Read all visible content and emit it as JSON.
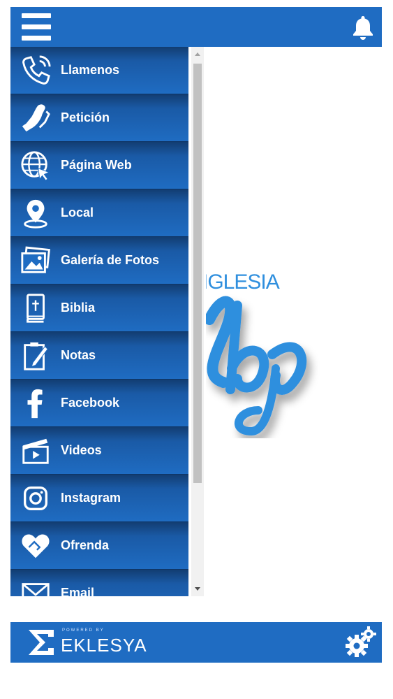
{
  "header": {
    "menu_icon": "hamburger-menu-icon",
    "notification_icon": "bell-icon"
  },
  "logo": {
    "top_text": "IGLESIA",
    "script_text": "ebp",
    "color": "#2f8fde"
  },
  "menu": {
    "items": [
      {
        "label": "Llamenos",
        "icon": "phone-icon"
      },
      {
        "label": "Petición",
        "icon": "praying-hands-icon"
      },
      {
        "label": "Página Web",
        "icon": "globe-cursor-icon"
      },
      {
        "label": "Local",
        "icon": "location-pin-icon"
      },
      {
        "label": "Galería de Fotos",
        "icon": "photo-gallery-icon"
      },
      {
        "label": "Biblia",
        "icon": "bible-icon"
      },
      {
        "label": "Notas",
        "icon": "notes-pencil-icon"
      },
      {
        "label": "Facebook",
        "icon": "facebook-icon"
      },
      {
        "label": "Videos",
        "icon": "video-clapper-icon"
      },
      {
        "label": "Instagram",
        "icon": "instagram-icon"
      },
      {
        "label": "Ofrenda",
        "icon": "heart-hands-icon"
      },
      {
        "label": "Email",
        "icon": "envelope-icon"
      }
    ]
  },
  "footer": {
    "powered_by": "POWERED BY",
    "brand": "EKLESYA",
    "settings_icon": "gears-icon"
  },
  "colors": {
    "primary": "#1f6cc2",
    "menu_dark": "#123d72",
    "text": "#ffffff"
  }
}
